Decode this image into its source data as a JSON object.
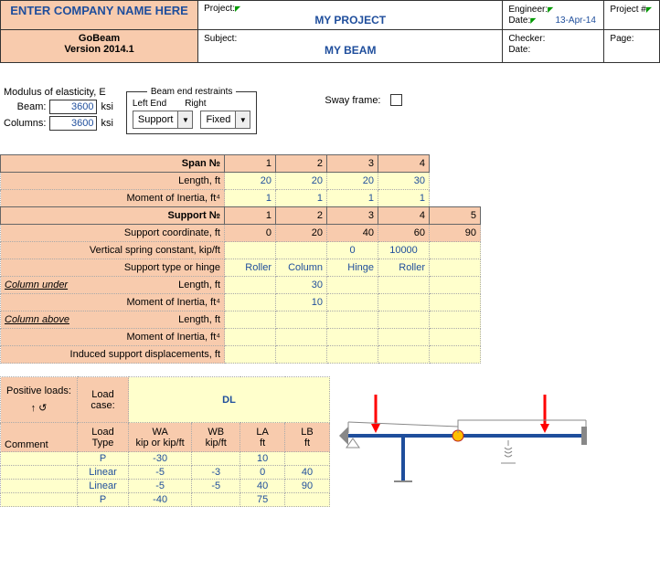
{
  "header": {
    "company": "ENTER COMPANY NAME HERE",
    "appname": "GoBeam",
    "version": "Version 2014.1",
    "project_label": "Project:",
    "project_value": "MY PROJECT",
    "subject_label": "Subject:",
    "subject_value": "MY BEAM",
    "engineer_label": "Engineer:",
    "date_label": "Date:",
    "date_value": "13-Apr-14",
    "checker_label": "Checker:",
    "date2_label": "Date:",
    "projectnum_label": "Project #",
    "page_label": "Page:"
  },
  "modulus": {
    "title": "Modulus of elasticity, E",
    "beam_label": "Beam:",
    "beam_value": "3600",
    "columns_label": "Columns:",
    "columns_value": "3600",
    "unit": "ksi"
  },
  "restraints": {
    "legend": "Beam end restraints",
    "left_label": "Left End",
    "right_label": "Right",
    "left_value": "Support",
    "right_value": "Fixed"
  },
  "sway": {
    "label": "Sway frame:"
  },
  "span": {
    "title": "Span №",
    "cols": [
      "1",
      "2",
      "3",
      "4"
    ],
    "length_label": "Length, ft",
    "length": [
      "20",
      "20",
      "20",
      "30"
    ],
    "moi_label": "Moment of Inertia, ft⁴",
    "moi": [
      "1",
      "1",
      "1",
      "1"
    ]
  },
  "support": {
    "title": "Support №",
    "cols": [
      "1",
      "2",
      "3",
      "4",
      "5"
    ],
    "coord_label": "Support coordinate, ft",
    "coord": [
      "0",
      "20",
      "40",
      "60",
      "90"
    ],
    "spring_label": "Vertical spring constant, kip/ft",
    "spring": [
      "",
      "",
      "0",
      "10000",
      ""
    ],
    "type_label": "Support type or hinge",
    "type": [
      "Roller",
      "Column",
      "Hinge",
      "Roller",
      ""
    ],
    "col_under_title": "Column under",
    "length_label": "Length, ft",
    "under_len": [
      "",
      "30",
      "",
      "",
      ""
    ],
    "moi_label": "Moment of Inertia, ft⁴",
    "under_moi": [
      "",
      "10",
      "",
      "",
      ""
    ],
    "col_above_title": "Column above",
    "above_len": [
      "",
      "",
      "",
      "",
      ""
    ],
    "above_moi": [
      "",
      "",
      "",
      "",
      ""
    ],
    "disp_label": "Induced support displacements, ft",
    "disp": [
      "",
      "",
      "",
      "",
      ""
    ]
  },
  "loads": {
    "positive_label": "Positive loads:",
    "arrows": "↑  ↺",
    "loadcase_label": "Load case:",
    "loadcase_value": "DL",
    "headers": {
      "comment": "Comment",
      "type": "Load\nType",
      "wa": "WA\nkip or kip/ft",
      "wb": "WB\nkip/ft",
      "la": "LA\nft",
      "lb": "LB\nft"
    },
    "rows": [
      {
        "type": "P",
        "wa": "-30",
        "wb": "",
        "la": "10",
        "lb": ""
      },
      {
        "type": "Linear",
        "wa": "-5",
        "wb": "-3",
        "la": "0",
        "lb": "40"
      },
      {
        "type": "Linear",
        "wa": "-5",
        "wb": "-5",
        "la": "40",
        "lb": "90"
      },
      {
        "type": "P",
        "wa": "-40",
        "wb": "",
        "la": "75",
        "lb": ""
      }
    ]
  }
}
